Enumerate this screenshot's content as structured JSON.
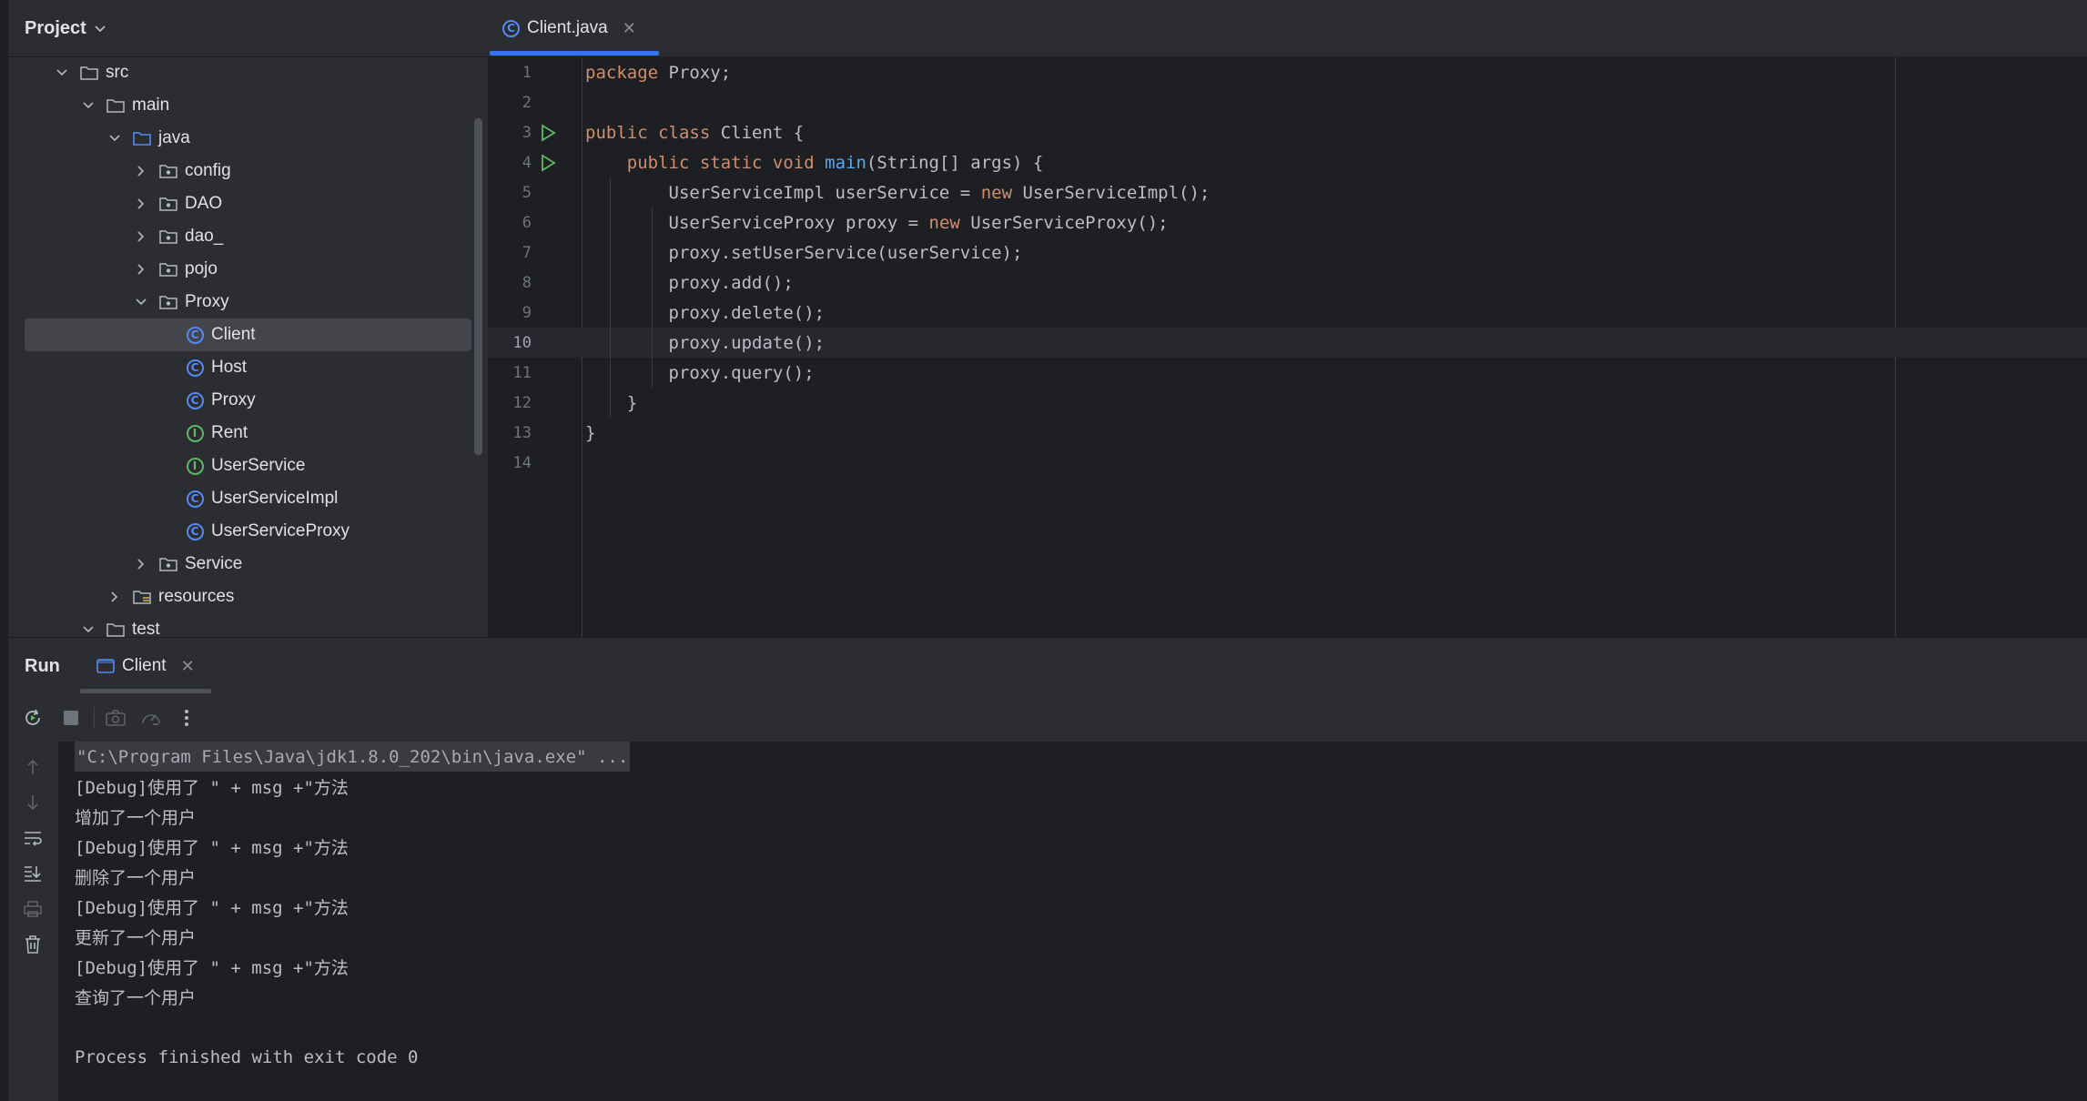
{
  "project_panel": {
    "title": "Project",
    "tree": [
      {
        "label": "src",
        "depth": 2,
        "expanded": true,
        "type": "folder"
      },
      {
        "label": "main",
        "depth": 3,
        "expanded": true,
        "type": "folder"
      },
      {
        "label": "java",
        "depth": 4,
        "expanded": true,
        "type": "source-folder"
      },
      {
        "label": "config",
        "depth": 5,
        "expanded": false,
        "type": "package"
      },
      {
        "label": "DAO",
        "depth": 5,
        "expanded": false,
        "type": "package"
      },
      {
        "label": "dao_",
        "depth": 5,
        "expanded": false,
        "type": "package"
      },
      {
        "label": "pojo",
        "depth": 5,
        "expanded": false,
        "type": "package"
      },
      {
        "label": "Proxy",
        "depth": 5,
        "expanded": true,
        "type": "package"
      },
      {
        "label": "Client",
        "depth": 6,
        "type": "class-runnable",
        "selected": true
      },
      {
        "label": "Host",
        "depth": 6,
        "type": "class"
      },
      {
        "label": "Proxy",
        "depth": 6,
        "type": "class"
      },
      {
        "label": "Rent",
        "depth": 6,
        "type": "interface"
      },
      {
        "label": "UserService",
        "depth": 6,
        "type": "interface"
      },
      {
        "label": "UserServiceImpl",
        "depth": 6,
        "type": "class"
      },
      {
        "label": "UserServiceProxy",
        "depth": 6,
        "type": "class"
      },
      {
        "label": "Service",
        "depth": 5,
        "expanded": false,
        "type": "package"
      },
      {
        "label": "resources",
        "depth": 4,
        "expanded": false,
        "type": "resources-folder"
      },
      {
        "label": "test",
        "depth": 3,
        "expanded": true,
        "type": "folder"
      }
    ]
  },
  "editor": {
    "tab_label": "Client.java",
    "current_line": 10,
    "lines": [
      {
        "n": "1",
        "tokens": [
          [
            "kw",
            "package"
          ],
          [
            "t",
            " Proxy;"
          ]
        ]
      },
      {
        "n": "2",
        "tokens": []
      },
      {
        "n": "3",
        "run": true,
        "tokens": [
          [
            "kw",
            "public class"
          ],
          [
            "t",
            " Client {"
          ]
        ]
      },
      {
        "n": "4",
        "run": true,
        "tokens": [
          [
            "t",
            "    "
          ],
          [
            "kw",
            "public static void"
          ],
          [
            "t",
            " "
          ],
          [
            "fn",
            "main"
          ],
          [
            "t",
            "(String[] args) {"
          ]
        ]
      },
      {
        "n": "5",
        "tokens": [
          [
            "t",
            "        UserServiceImpl userService = "
          ],
          [
            "kw",
            "new"
          ],
          [
            "t",
            " UserServiceImpl();"
          ]
        ]
      },
      {
        "n": "6",
        "tokens": [
          [
            "t",
            "        UserServiceProxy proxy = "
          ],
          [
            "kw",
            "new"
          ],
          [
            "t",
            " UserServiceProxy();"
          ]
        ]
      },
      {
        "n": "7",
        "tokens": [
          [
            "t",
            "        proxy.setUserService(userService);"
          ]
        ]
      },
      {
        "n": "8",
        "tokens": [
          [
            "t",
            "        proxy.add();"
          ]
        ]
      },
      {
        "n": "9",
        "tokens": [
          [
            "t",
            "        proxy.delete();"
          ]
        ]
      },
      {
        "n": "10",
        "tokens": [
          [
            "t",
            "        proxy.update();"
          ]
        ]
      },
      {
        "n": "11",
        "tokens": [
          [
            "t",
            "        proxy.query();"
          ]
        ]
      },
      {
        "n": "12",
        "tokens": [
          [
            "t",
            "    }"
          ]
        ]
      },
      {
        "n": "13",
        "tokens": [
          [
            "t",
            "}"
          ]
        ]
      },
      {
        "n": "14",
        "tokens": []
      }
    ]
  },
  "run_panel": {
    "title": "Run",
    "tab_label": "Client",
    "output": [
      "\"C:\\Program Files\\Java\\jdk1.8.0_202\\bin\\java.exe\" ...",
      "[Debug]使用了 \" + msg +\"方法",
      "增加了一个用户",
      "[Debug]使用了 \" + msg +\"方法",
      "删除了一个用户",
      "[Debug]使用了 \" + msg +\"方法",
      "更新了一个用户",
      "[Debug]使用了 \" + msg +\"方法",
      "查询了一个用户",
      "",
      "Process finished with exit code 0"
    ]
  },
  "colors": {
    "keyword": "#cf8e6d",
    "function": "#56a8f5",
    "class_icon": "#548af7",
    "interface_icon": "#5fb865",
    "run_icon": "#5fb865",
    "tab_accent": "#3574f0"
  },
  "icons": {
    "tree_folder": "folder-icon",
    "tree_package": "package-icon",
    "tree_class": "class-icon",
    "tree_interface": "interface-icon",
    "run_gutter": "run-triangle-icon",
    "rerun": "rerun-icon",
    "stop": "stop-icon",
    "screenshot": "camera-icon",
    "profiler": "gauge-icon",
    "more": "more-vertical-icon"
  }
}
